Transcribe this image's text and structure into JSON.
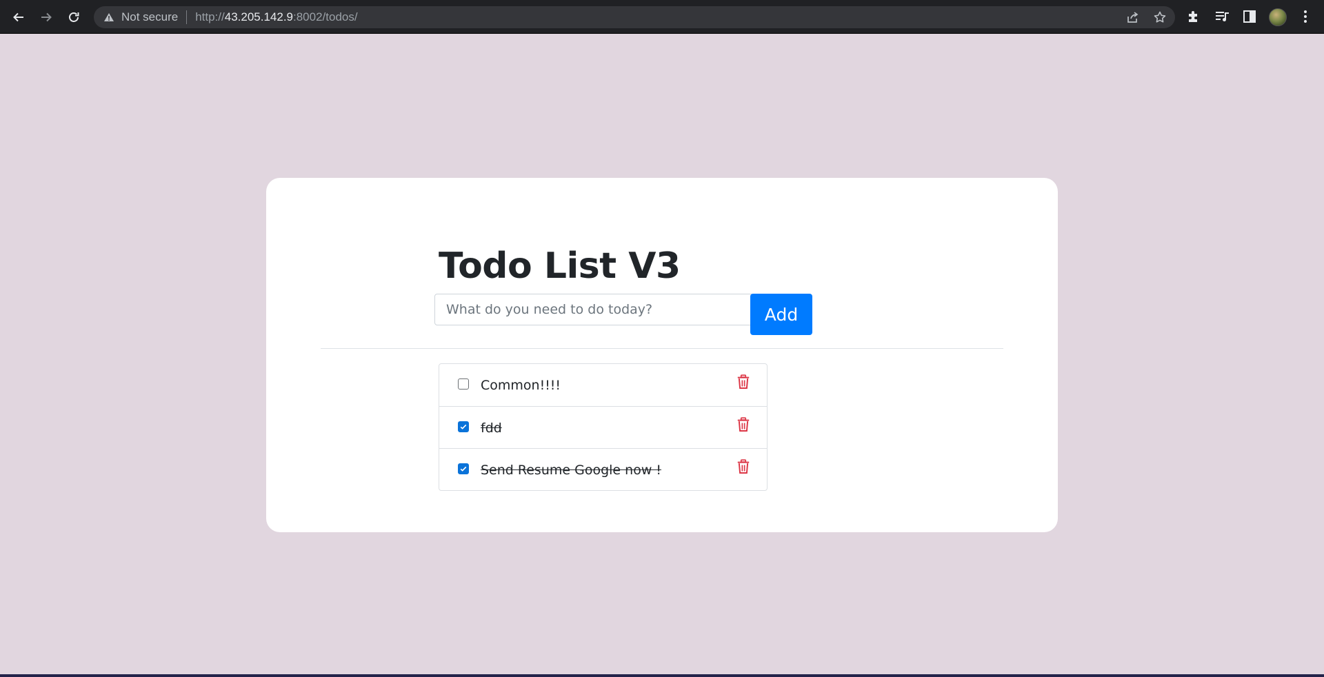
{
  "browser": {
    "security_label": "Not secure",
    "url_scheme": "http://",
    "url_host": "43.205.142.9",
    "url_path": ":8002/todos/"
  },
  "page": {
    "title": "Todo List V3",
    "input_placeholder": "What do you need to do today?",
    "input_value": "",
    "add_label": "Add"
  },
  "todos": [
    {
      "text": "Common!!!!",
      "completed": false
    },
    {
      "text": "fdd",
      "completed": true
    },
    {
      "text": "Send Resume Google now !",
      "completed": true
    }
  ],
  "colors": {
    "background": "#e1d6df",
    "accent": "#007bff",
    "delete": "#dc3545"
  },
  "icons": {
    "back": "arrow-left-icon",
    "forward": "arrow-right-icon",
    "reload": "reload-icon",
    "warning": "warning-icon",
    "share": "share-icon",
    "bookmark": "star-icon",
    "extensions": "puzzle-icon",
    "media": "playlist-icon",
    "side_panel": "side-panel-icon",
    "menu": "kebab-menu-icon",
    "delete": "trash-icon"
  }
}
